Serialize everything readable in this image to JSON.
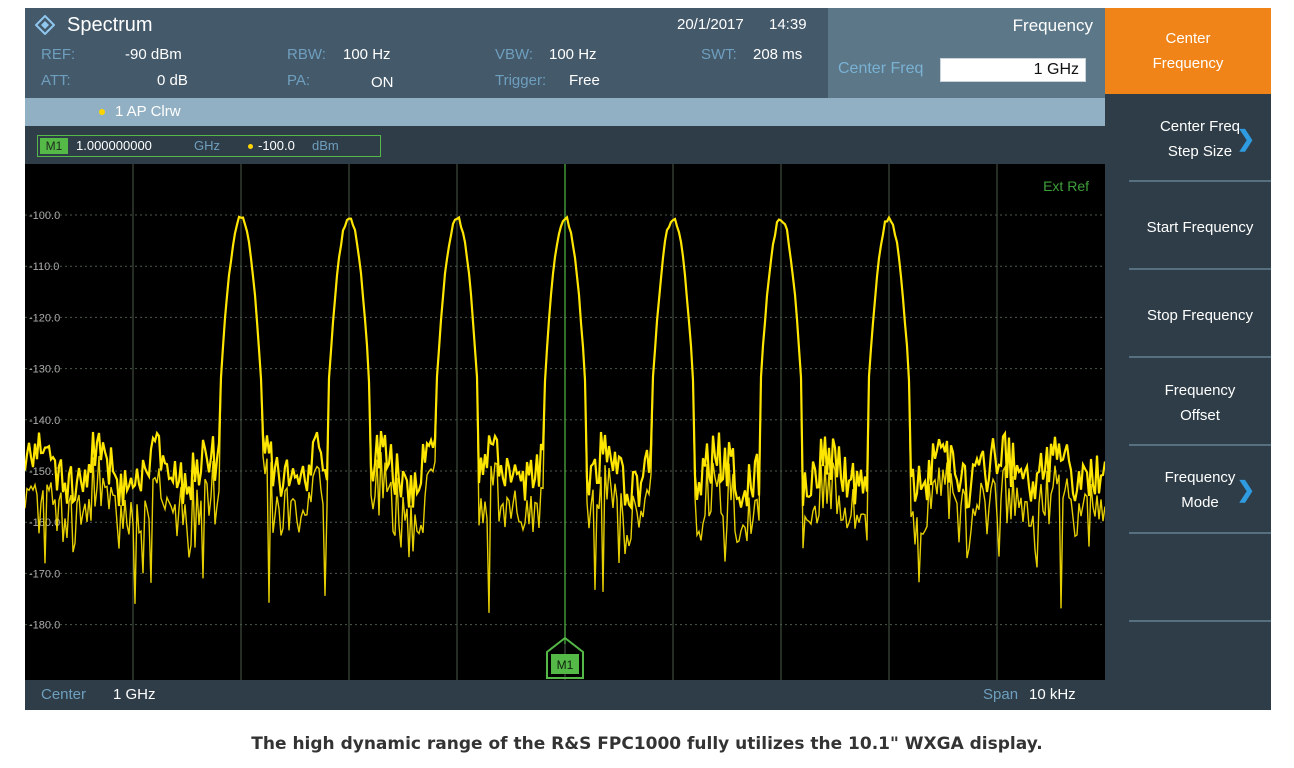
{
  "header": {
    "app_title": "Spectrum",
    "date": "20/1/2017",
    "time": "14:39"
  },
  "params": {
    "ref_label": "REF:",
    "ref_value": "-90 dBm",
    "att_label": "ATT:",
    "att_value": "0 dB",
    "rbw_label": "RBW:",
    "rbw_value": "100 Hz",
    "pa_label": "PA:",
    "pa_value": "ON",
    "vbw_label": "VBW:",
    "vbw_value": "100 Hz",
    "trigger_label": "Trigger:",
    "trigger_value": "Free",
    "swt_label": "SWT:",
    "swt_value": "208 ms"
  },
  "freq_panel": {
    "title": "Frequency",
    "center_label": "Center Freq",
    "center_value": "1 GHz"
  },
  "trace": {
    "label": "1 AP Clrw"
  },
  "marker": {
    "tag": "M1",
    "freq": "1.000000000",
    "freq_unit": "GHz",
    "amp": "-100.0",
    "amp_unit": "dBm"
  },
  "plot": {
    "ext_ref": "Ext Ref",
    "y_ticks": [
      "-100.0",
      "-110.0",
      "-120.0",
      "-130.0",
      "-140.0",
      "-150.0",
      "-160.0",
      "-170.0",
      "-180.0"
    ],
    "marker_tag": "M1",
    "trace_color": "#ffe600",
    "grid_color": "#4a5a4a",
    "marker_color": "#54b946"
  },
  "footer": {
    "center_label": "Center",
    "center_value": "1 GHz",
    "span_label": "Span",
    "span_value": "10 kHz"
  },
  "softkeys": [
    {
      "line1": "Center",
      "line2": "Frequency",
      "active": true
    },
    {
      "line1": "Center Freq",
      "line2": "Step Size",
      "chevron": true
    },
    {
      "line1": "Start Frequency",
      "line2": ""
    },
    {
      "line1": "Stop Frequency",
      "line2": ""
    },
    {
      "line1": "Frequency",
      "line2": "Offset"
    },
    {
      "line1": "Frequency",
      "line2": "Mode",
      "chevron": true
    }
  ],
  "caption": "The high dynamic range of the R&S FPC1000 fully utilizes the 10.1\" WXGA display.",
  "icons": {
    "app": "spectrum-diamond-icon",
    "chevron": "chevron-right-icon"
  }
}
